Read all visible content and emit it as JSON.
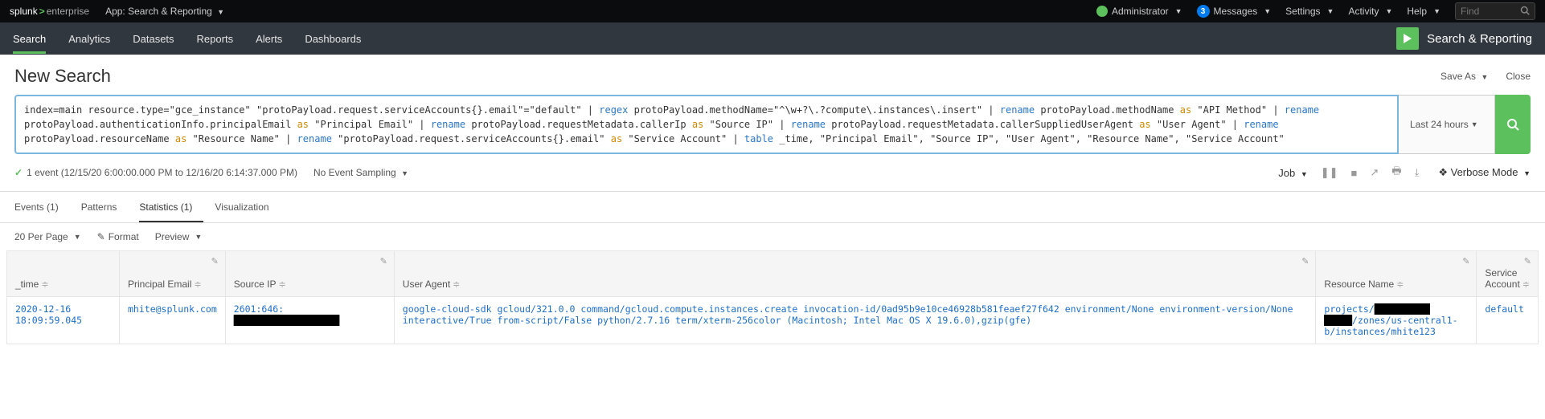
{
  "header": {
    "logo_splunk": "splunk",
    "logo_enterprise": "enterprise",
    "app_label": "App: Search & Reporting",
    "user": "Administrator",
    "messages_label": "Messages",
    "messages_count": "3",
    "settings": "Settings",
    "activity": "Activity",
    "help": "Help",
    "find_placeholder": "Find"
  },
  "nav": {
    "items": [
      "Search",
      "Analytics",
      "Datasets",
      "Reports",
      "Alerts",
      "Dashboards"
    ],
    "active_index": 0,
    "app_title": "Search & Reporting"
  },
  "title": {
    "page_title": "New Search",
    "save_as": "Save As",
    "close": "Close"
  },
  "search": {
    "time_range": "Last 24 hours",
    "query_plain": "index=main resource.type=\"gce_instance\" \"protoPayload.request.serviceAccounts{}.email\"=\"default\" | regex protoPayload.methodName=\"^\\w+?\\.?compute\\.instances\\.insert\" | rename protoPayload.methodName as \"API Method\" | rename protoPayload.authenticationInfo.principalEmail as \"Principal Email\" | rename protoPayload.requestMetadata.callerIp as \"Source IP\" | rename protoPayload.requestMetadata.callerSuppliedUserAgent as \"User Agent\" | rename protoPayload.resourceName as \"Resource Name\" | rename \"protoPayload.request.serviceAccounts{}.email\" as \"Service Account\" | table _time, \"Principal Email\", \"Source IP\", \"User Agent\", \"Resource Name\", \"Service Account\""
  },
  "status": {
    "event_text": "1 event (12/15/20 6:00:00.000 PM to 12/16/20 6:14:37.000 PM)",
    "sampling": "No Event Sampling",
    "job_label": "Job",
    "mode": "Verbose Mode"
  },
  "tabs": {
    "events": "Events (1)",
    "patterns": "Patterns",
    "statistics": "Statistics (1)",
    "visualization": "Visualization"
  },
  "toolbar": {
    "per_page": "20 Per Page",
    "format": "Format",
    "preview": "Preview"
  },
  "table": {
    "headers": {
      "time": "_time",
      "principal_email": "Principal Email",
      "source_ip": "Source IP",
      "user_agent": "User Agent",
      "resource_name": "Resource Name",
      "service_account": "Service Account"
    },
    "row": {
      "time": "2020-12-16 18:09:59.045",
      "principal_email": "mhite@splunk.com",
      "source_ip_prefix": "2601:646:",
      "source_ip_redacted": "███████████████████",
      "user_agent": "google-cloud-sdk gcloud/321.0.0 command/gcloud.compute.instances.create invocation-id/0ad95b9e10ce46928b581feaef27f642 environment/None environment-version/None interactive/True from-script/False python/2.7.16 term/xterm-256color (Macintosh; Intel Mac OS X 19.6.0),gzip(gfe)",
      "resource_name_p1": "projects/",
      "resource_name_red1": "██████████",
      "resource_name_red2": "█████",
      "resource_name_p2": "/zones/us-central1-b/instances/mhite123",
      "service_account": "default"
    }
  }
}
